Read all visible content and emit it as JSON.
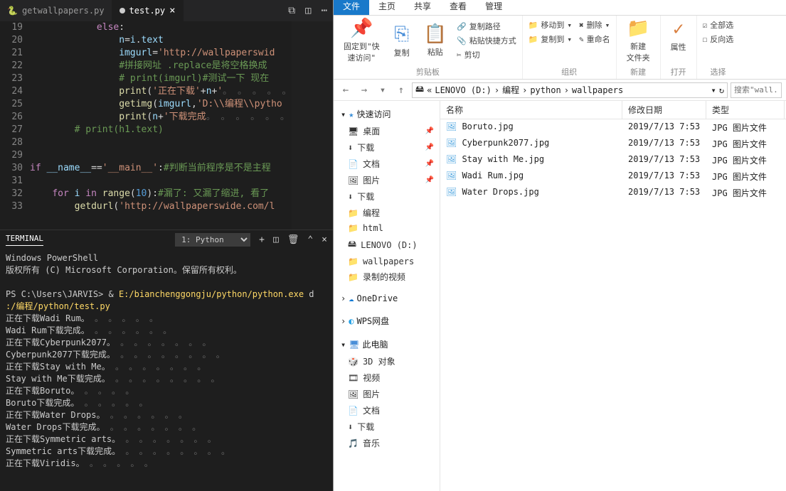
{
  "vscode": {
    "tabs": [
      {
        "icon": "py",
        "label": "getwallpapers.py",
        "active": false
      },
      {
        "icon": "py",
        "label": "test.py",
        "active": true
      }
    ],
    "lines": [
      {
        "n": 19,
        "html": "            <span class='c-key'>else</span><span class='c-op'>:</span>"
      },
      {
        "n": 20,
        "html": "                <span class='c-var'>n</span><span class='c-op'>=</span><span class='c-var'>i</span><span class='c-op'>.</span><span class='c-var'>text</span>"
      },
      {
        "n": 21,
        "html": "                <span class='c-var'>imgurl</span><span class='c-op'>=</span><span class='c-str'>'http://wallpaperswid</span>"
      },
      {
        "n": 22,
        "html": "                <span class='c-com'>#拼接网址 .replace是将空格换成</span>"
      },
      {
        "n": 23,
        "html": "                <span class='c-com'># print(imgurl)#测试一下 现在</span>"
      },
      {
        "n": 24,
        "html": "                <span class='c-fn'>print</span><span class='c-op'>(</span><span class='c-str'>'正在下载'</span><span class='c-op'>+</span><span class='c-var'>n</span><span class='c-op'>+</span><span class='c-str'>'</span><span class='dots'>。 。 。 。 。</span>"
      },
      {
        "n": 25,
        "html": "                <span class='c-fn'>getimg</span><span class='c-op'>(</span><span class='c-var'>imgurl</span><span class='c-op'>,</span><span class='c-str'>'D:\\\\编程\\\\pytho</span>"
      },
      {
        "n": 26,
        "html": "                <span class='c-fn'>print</span><span class='c-op'>(</span><span class='c-var'>n</span><span class='c-op'>+</span><span class='c-str'>'下载完成</span><span class='dots'>。 。 。 。 。 。</span>"
      },
      {
        "n": 27,
        "html": "        <span class='c-com'># print(h1.text)</span>"
      },
      {
        "n": 28,
        "html": ""
      },
      {
        "n": 29,
        "html": ""
      },
      {
        "n": 30,
        "html": "<span class='c-key'>if</span> <span class='c-var'>__name__</span><span class='c-op'>==</span><span class='c-str'>'__main__'</span><span class='c-op'>:</span><span class='c-com'>#判断当前程序是不是主程</span>"
      },
      {
        "n": 31,
        "html": ""
      },
      {
        "n": 32,
        "html": "    <span class='c-key'>for</span> <span class='c-var'>i</span> <span class='c-key'>in</span> <span class='c-fn'>range</span><span class='c-op'>(</span><span class='c-def'>10</span><span class='c-op'>):</span><span class='c-com'>#漏了: 又漏了缩进, 看了</span>"
      },
      {
        "n": 33,
        "html": "        <span class='c-fn'>getdurl</span><span class='c-op'>(</span><span class='c-str'>'http://wallpaperswide.com/l</span>"
      }
    ],
    "terminal": {
      "label": "TERMINAL",
      "selector": "1: Python",
      "lines": [
        {
          "t": "Windows PowerShell"
        },
        {
          "t": "版权所有 (C) Microsoft Corporation。保留所有权利。"
        },
        {
          "t": ""
        },
        {
          "pre": "PS C:\\Users\\JARVIS> & ",
          "cmd": "E:/bianchenggongju/python/python.exe",
          "post": " d"
        },
        {
          "cmd": ":/编程/python/test.py"
        },
        {
          "t": "正在下载Wadi Rum。",
          "d": 5
        },
        {
          "t": "Wadi Rum下载完成。",
          "d": 6
        },
        {
          "t": "正在下载Cyberpunk2077。",
          "d": 7
        },
        {
          "t": "Cyberpunk2077下载完成。",
          "d": 8
        },
        {
          "t": "正在下载Stay with Me。",
          "d": 7
        },
        {
          "t": "Stay with Me下载完成。",
          "d": 8
        },
        {
          "t": "正在下载Boruto。",
          "d": 4
        },
        {
          "t": "Boruto下载完成。",
          "d": 5
        },
        {
          "t": "正在下载Water Drops。",
          "d": 6
        },
        {
          "t": "Water Drops下载完成。",
          "d": 7
        },
        {
          "t": "正在下载Symmetric arts。",
          "d": 7
        },
        {
          "t": "Symmetric arts下载完成。",
          "d": 8
        },
        {
          "t": "正在下载Viridis。",
          "d": 5
        }
      ]
    }
  },
  "explorer": {
    "topTabs": [
      "文件",
      "主页",
      "共享",
      "查看",
      "管理"
    ],
    "ribbon": {
      "clip": {
        "pin": "固定到\"快\n速访问\"",
        "copy": "复制",
        "paste": "粘贴",
        "copyPath": "复制路径",
        "pasteShort": "粘贴快捷方式",
        "cut": "剪切",
        "label": "剪贴板"
      },
      "org": {
        "move": "移动到",
        "copyTo": "复制到",
        "del": "删除",
        "rename": "重命名",
        "label": "组织"
      },
      "new": {
        "folder": "新建\n文件夹",
        "label": "新建"
      },
      "open": {
        "prop": "属性",
        "label": "打开"
      },
      "select": {
        "all": "全部选",
        "inv": "反向选",
        "label": "选择"
      }
    },
    "breadcrumb": [
      "LENOVO (D:)",
      "编程",
      "python",
      "wallpapers"
    ],
    "searchPlaceholder": "搜索\"wall..",
    "nav": {
      "quick": "快速访问",
      "items1": [
        "桌面",
        "下载",
        "文档",
        "图片",
        "下载",
        "编程",
        "html",
        "LENOVO (D:)",
        "wallpapers",
        "录制的视频"
      ],
      "onedrive": "OneDrive",
      "wps": "WPS网盘",
      "thispc": "此电脑",
      "items2": [
        "3D 对象",
        "视频",
        "图片",
        "文档",
        "下载",
        "音乐"
      ]
    },
    "columns": {
      "name": "名称",
      "date": "修改日期",
      "type": "类型"
    },
    "files": [
      {
        "name": "Boruto.jpg",
        "date": "2019/7/13 7:53",
        "type": "JPG 图片文件"
      },
      {
        "name": "Cyberpunk2077.jpg",
        "date": "2019/7/13 7:53",
        "type": "JPG 图片文件"
      },
      {
        "name": "Stay with Me.jpg",
        "date": "2019/7/13 7:53",
        "type": "JPG 图片文件"
      },
      {
        "name": "Wadi Rum.jpg",
        "date": "2019/7/13 7:53",
        "type": "JPG 图片文件"
      },
      {
        "name": "Water Drops.jpg",
        "date": "2019/7/13 7:53",
        "type": "JPG 图片文件"
      }
    ]
  }
}
